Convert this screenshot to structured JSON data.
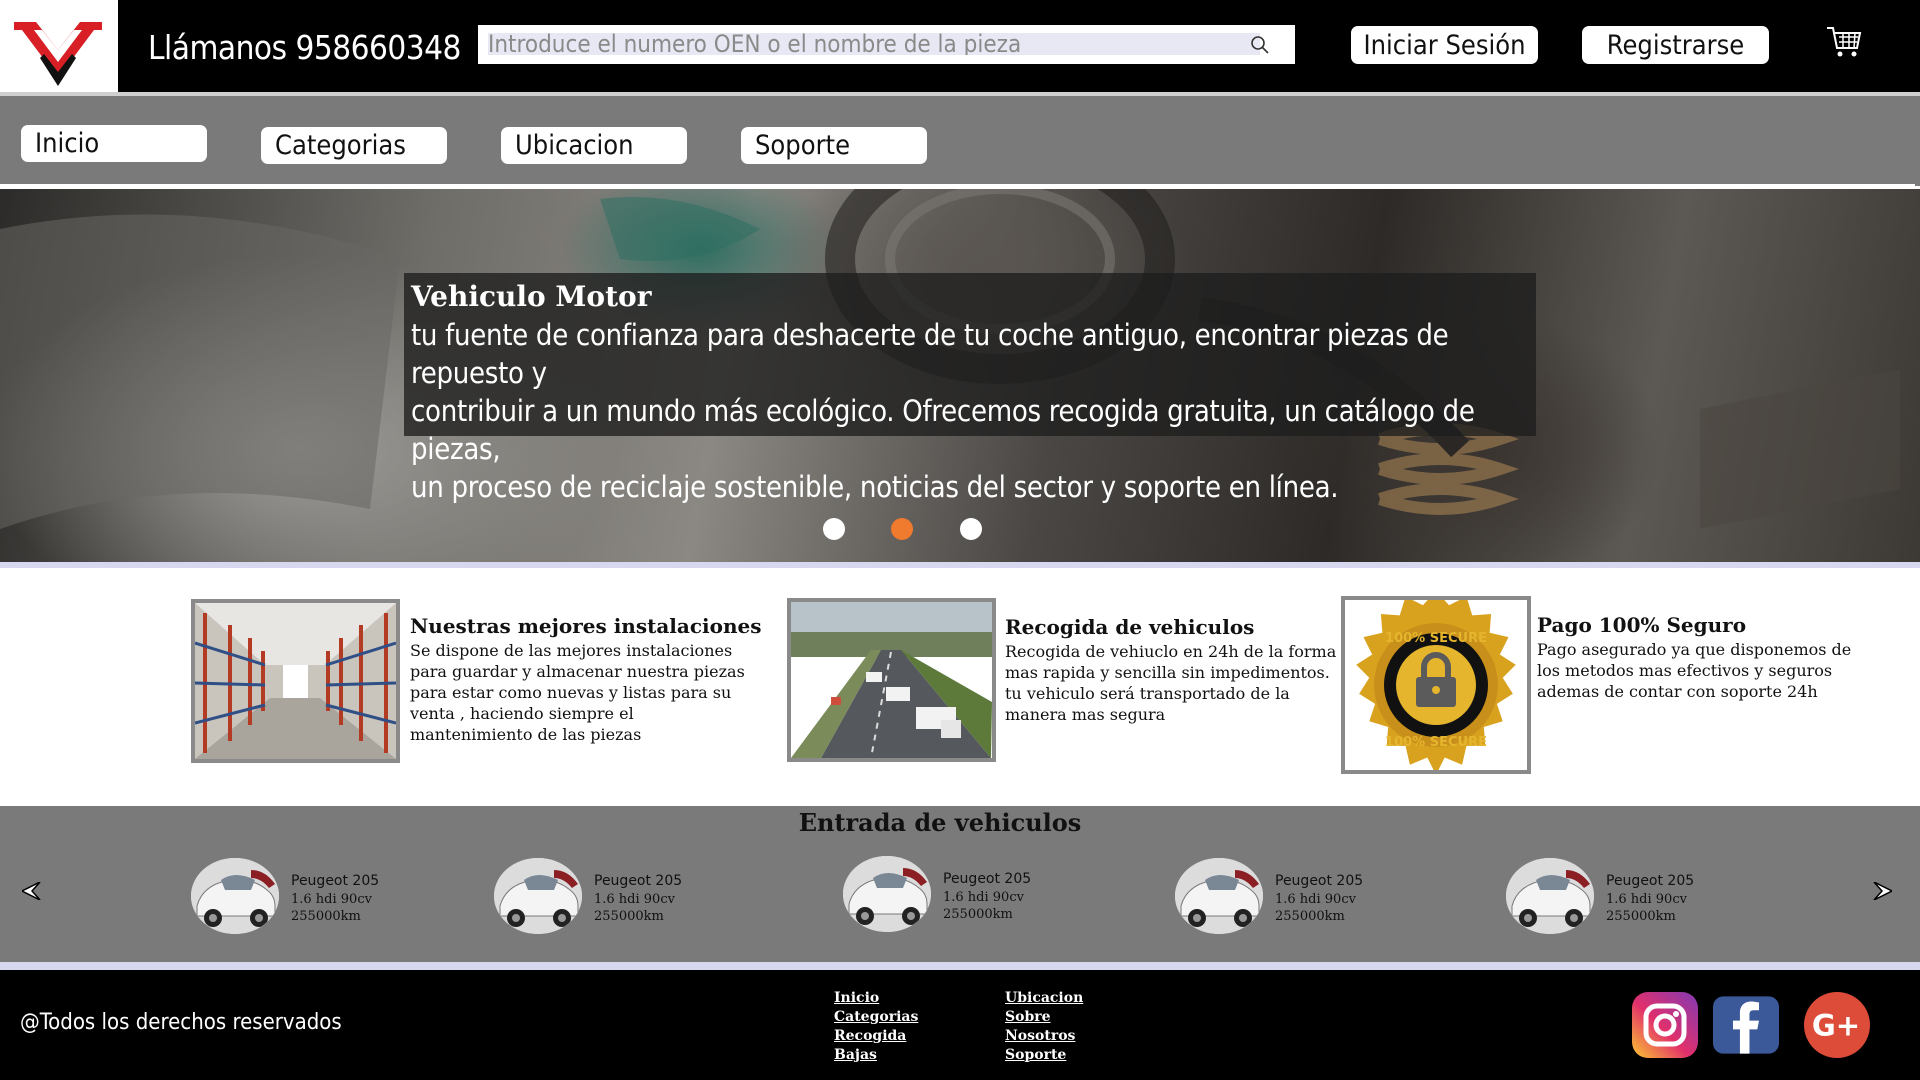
{
  "header": {
    "phone": "Llámanos 958660348",
    "search_placeholder": "Introduce el numero OEN o el nombre de la pieza",
    "login": "Iniciar Sesión",
    "register": "Registrarse"
  },
  "nav": [
    "Inicio",
    "Categorias",
    "Ubicacion",
    "Soporte"
  ],
  "hero": {
    "title": "Vehiculo Motor",
    "lines": [
      "tu fuente de confianza para deshacerte de tu coche antiguo, encontrar piezas de repuesto y",
      "contribuir a un mundo más ecológico. Ofrecemos recogida gratuita, un catálogo de piezas,",
      "un proceso de reciclaje sostenible, noticias del sector y soporte en línea."
    ],
    "active_slide": 1,
    "slide_count": 3
  },
  "features": [
    {
      "title": "Nuestras mejores instalaciones",
      "lines": [
        "Se dispone de las mejores instalaciones",
        "para guardar y almacenar nuestra piezas",
        "para estar como nuevas y listas para su",
        "venta , haciendo siempre el",
        "mantenimiento de las piezas"
      ]
    },
    {
      "title": "Recogida de vehiculos",
      "lines": [
        "Recogida de vehiuclo en 24h de la forma",
        "mas rapida y sencilla sin impedimentos.",
        "tu vehiculo será transportado de la",
        "manera mas segura"
      ]
    },
    {
      "title": "Pago 100% Seguro",
      "lines": [
        "Pago asegurado ya que disponemos de",
        "los metodos mas efectivos y seguros",
        "ademas de contar con soporte 24h"
      ],
      "badge_text": "100% SECURE"
    }
  ],
  "vehicles": {
    "heading": "Entrada de vehiculos",
    "items": [
      {
        "name": "Peugeot 205",
        "engine": "1.6 hdi 90cv",
        "km": "255000km"
      },
      {
        "name": "Peugeot 205",
        "engine": "1.6 hdi 90cv",
        "km": "255000km"
      },
      {
        "name": "Peugeot 205",
        "engine": "1.6 hdi 90cv",
        "km": "255000km"
      },
      {
        "name": "Peugeot 205",
        "engine": "1.6 hdi 90cv",
        "km": "255000km"
      },
      {
        "name": "Peugeot 205",
        "engine": "1.6 hdi 90cv",
        "km": "255000km"
      }
    ]
  },
  "footer": {
    "copyright": "@Todos los derechos reservados",
    "links_col1": [
      "Inicio",
      "Categorias",
      "Recogida",
      "Bajas"
    ],
    "links_col2": [
      "Ubicacion",
      "Sobre",
      "Nosotros",
      "Soporte"
    ]
  },
  "colors": {
    "brand_red": "#d81f26",
    "header_bg": "#000000",
    "nav_bg": "#7a7a7a",
    "active_dot": "#f07a2e"
  }
}
